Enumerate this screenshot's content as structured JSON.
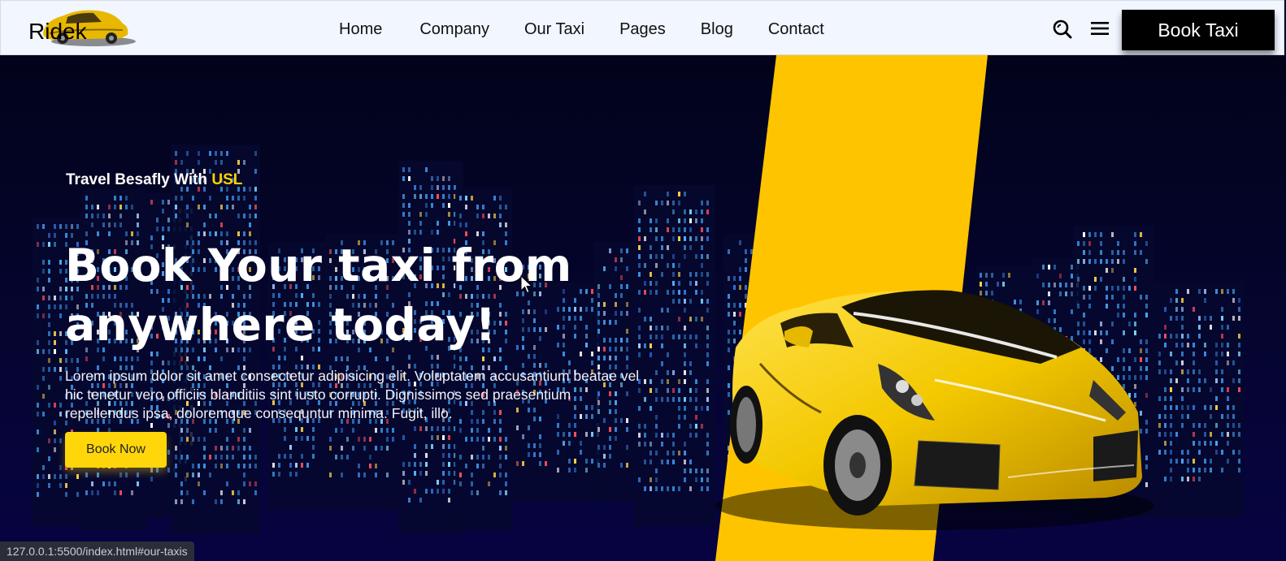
{
  "header": {
    "logo_text": "Ridek",
    "nav": [
      "Home",
      "Company",
      "Our Taxi",
      "Pages",
      "Blog",
      "Contact"
    ],
    "book_taxi_label": "Book Taxi"
  },
  "hero": {
    "tagline_prefix": "Travel Besafly With ",
    "tagline_highlight": "USL",
    "headline_line1": "Book Your taxi from",
    "headline_line2": "anywhere today!",
    "paragraph": "Lorem ipsum dolor sit amet consectetur adipisicing elit. Voluptatem accusantium beatae vel hic tenetur vero officiis blanditiis sint iusto corrupti. Dignissimos sed praesentium repellendus ipsa, doloremque consequntur minima. Fugit, illo.",
    "book_now_label": "Book Now"
  },
  "status_bar": {
    "url": "127.0.0.1:5500/index.html#our-taxis"
  },
  "colors": {
    "accent_yellow": "#ffd100",
    "stripe_yellow": "#ffc400",
    "hero_bg": "#050530",
    "header_bg": "#f1f6ff",
    "button_black": "#000000"
  },
  "icons": [
    "taxi-logo-icon",
    "search-icon",
    "hamburger-menu-icon",
    "mouse-cursor-icon",
    "sports-car-illustration"
  ]
}
